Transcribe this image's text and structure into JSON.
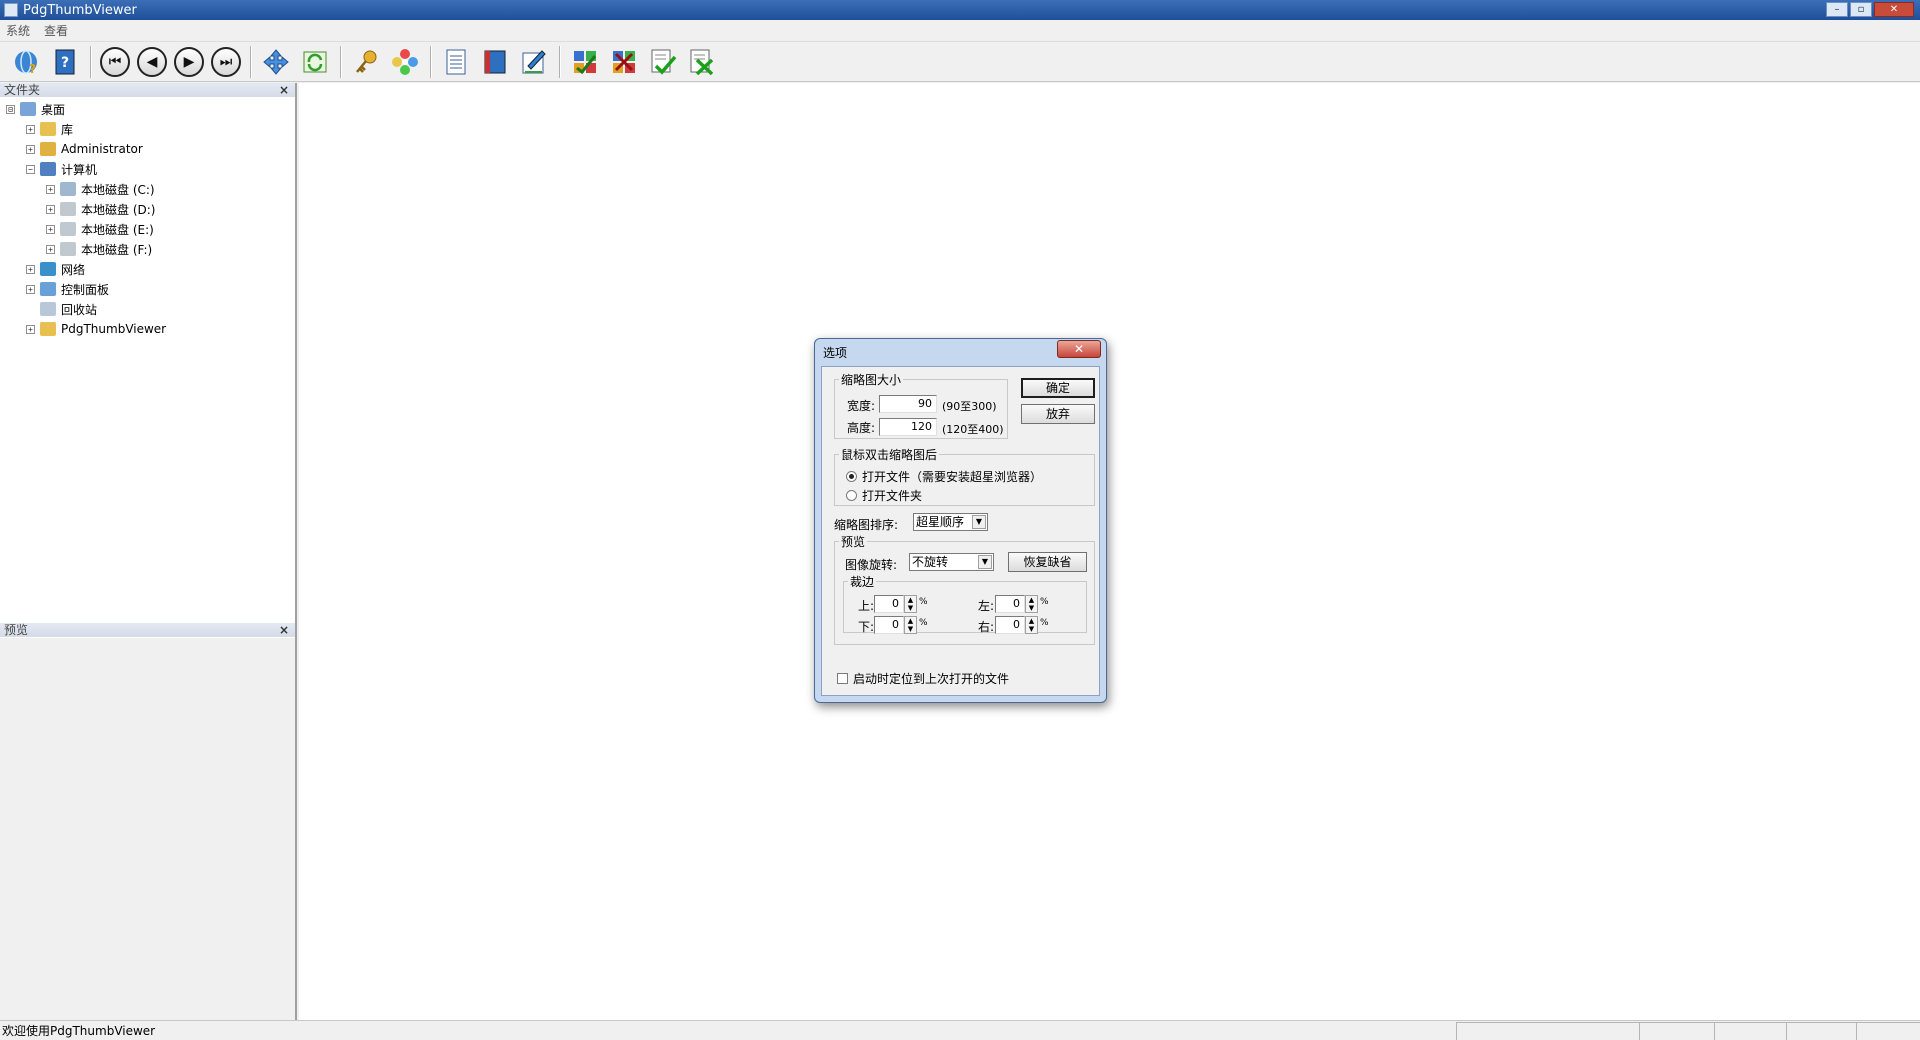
{
  "window": {
    "title": "PdgThumbViewer",
    "controls": [
      "–",
      "▫",
      "✕"
    ]
  },
  "menu": {
    "items": [
      "系统",
      "查看"
    ]
  },
  "toolbar": {
    "icons": [
      "help-globe-icon",
      "help-book-icon",
      "first-page-icon",
      "prev-page-icon",
      "next-page-icon",
      "last-page-icon",
      "move-icon",
      "refresh-icon",
      "key-icon",
      "flower-icon",
      "list-icon",
      "book-icon",
      "edit-icon",
      "puzzle-add-icon",
      "puzzle-remove-icon",
      "check-list-icon",
      "cross-list-icon"
    ],
    "glyphs": {
      "first": "⏮",
      "prev": "◀",
      "next": "▶",
      "last": "⏭"
    }
  },
  "folder_panel": {
    "title": "文件夹",
    "close": "×",
    "tree": [
      {
        "label": "桌面",
        "level": 0,
        "expander": "⊟"
      },
      {
        "label": "库",
        "level": 1,
        "expander": "+"
      },
      {
        "label": "Administrator",
        "level": 1,
        "expander": "+"
      },
      {
        "label": "计算机",
        "level": 1,
        "expander": "−"
      },
      {
        "label": "本地磁盘 (C:)",
        "level": 2,
        "expander": "+"
      },
      {
        "label": "本地磁盘 (D:)",
        "level": 2,
        "expander": "+"
      },
      {
        "label": "本地磁盘 (E:)",
        "level": 2,
        "expander": "+"
      },
      {
        "label": "本地磁盘 (F:)",
        "level": 2,
        "expander": "+"
      },
      {
        "label": "网络",
        "level": 1,
        "expander": "+"
      },
      {
        "label": "控制面板",
        "level": 1,
        "expander": "+"
      },
      {
        "label": "回收站",
        "level": 1,
        "expander": ""
      },
      {
        "label": "PdgThumbViewer",
        "level": 1,
        "expander": "+"
      }
    ]
  },
  "preview_panel": {
    "title": "预览",
    "close": "×"
  },
  "status": {
    "text": "欢迎使用PdgThumbViewer"
  },
  "dialog": {
    "title": "选项",
    "close": "✕",
    "thumb_size": {
      "legend": "缩略图大小",
      "width_label": "宽度:",
      "width_value": "90",
      "width_range": "(90至300)",
      "height_label": "高度:",
      "height_value": "120",
      "height_range": "(120至400)"
    },
    "ok_label": "确定",
    "cancel_label": "放弃",
    "dblclick": {
      "legend": "鼠标双击缩略图后",
      "option1": "打开文件（需要安装超星浏览器）",
      "option2": "打开文件夹",
      "selected": "option1"
    },
    "sort": {
      "label": "缩略图排序:",
      "value": "超星顺序"
    },
    "preview": {
      "legend": "预览",
      "rotate_label": "图像旋转:",
      "rotate_value": "不旋转",
      "restore_label": "恢复缺省",
      "crop": {
        "legend": "裁边",
        "top_label": "上:",
        "top_value": "0",
        "bottom_label": "下:",
        "bottom_value": "0",
        "left_label": "左:",
        "left_value": "0",
        "right_label": "右:",
        "right_value": "0",
        "unit": "%"
      }
    },
    "startup_checkbox": "启动时定位到上次打开的文件",
    "startup_checked": false
  }
}
